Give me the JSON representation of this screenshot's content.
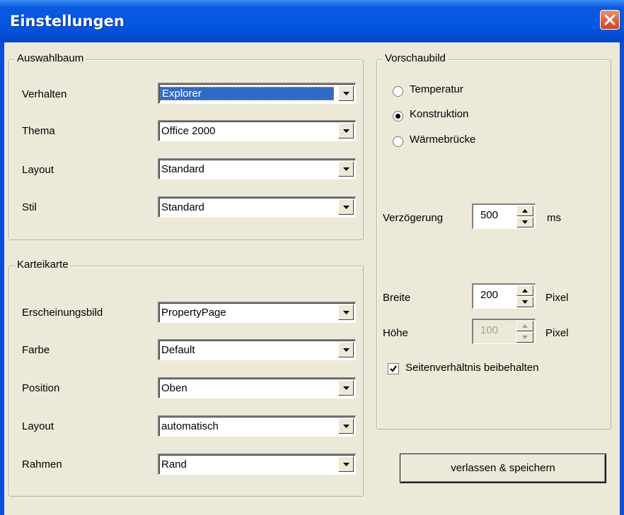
{
  "window": {
    "title": "Einstellungen"
  },
  "auswahlbaum": {
    "legend": "Auswahlbaum",
    "rows": [
      {
        "label": "Verhalten",
        "value": "Explorer"
      },
      {
        "label": "Thema",
        "value": "Office 2000"
      },
      {
        "label": "Layout",
        "value": "Standard"
      },
      {
        "label": "Stil",
        "value": "Standard"
      }
    ]
  },
  "karteikarte": {
    "legend": "Karteikarte",
    "rows": [
      {
        "label": "Erscheinungsbild",
        "value": "PropertyPage"
      },
      {
        "label": "Farbe",
        "value": "Default"
      },
      {
        "label": "Position",
        "value": "Oben"
      },
      {
        "label": "Layout",
        "value": "automatisch"
      },
      {
        "label": "Rahmen",
        "value": "Rand"
      }
    ]
  },
  "vorschaubild": {
    "legend": "Vorschaubild",
    "radios": [
      {
        "label": "Temperatur",
        "selected": false
      },
      {
        "label": "Konstruktion",
        "selected": true
      },
      {
        "label": "Wärmebrücke",
        "selected": false
      }
    ],
    "delay": {
      "label": "Verzögerung",
      "value": "500",
      "unit": "ms"
    },
    "width": {
      "label": "Breite",
      "value": "200",
      "unit": "Pixel"
    },
    "height": {
      "label": "Höhe",
      "value": "100",
      "unit": "Pixel",
      "enabled": false
    },
    "keep_ratio": {
      "label": "Seitenverhältnis beibehalten",
      "checked": true
    }
  },
  "save_button": "verlassen & speichern",
  "colors": {
    "titlebar": "#0455e1",
    "face": "#ece9d8",
    "selection": "#316ac5",
    "close": "#d2411c"
  }
}
